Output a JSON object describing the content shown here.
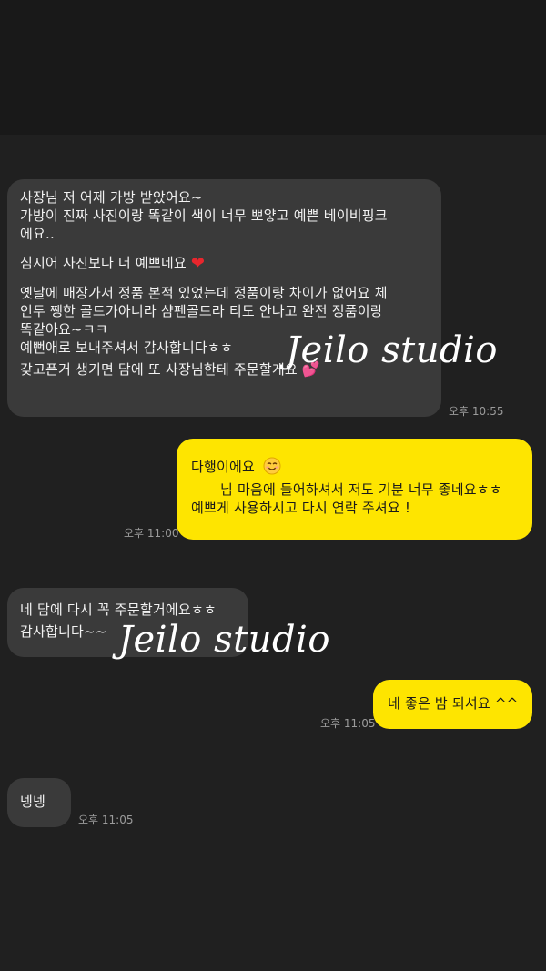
{
  "messages": [
    {
      "direction": "incoming",
      "lines": [
        "사장님 저 어제 가방 받았어요~",
        "가방이 진짜 사진이랑 똑같이 색이 너무 뽀얗고 예쁜 베이비핑크",
        "에요..",
        "심지어 사진보다 더 예쁘네요",
        "옛날에 매장가서 정품 본적 있었는데 정품이랑 차이가 없어요 체",
        "인두 쨍한 골드가아니라 샴펜골드라 티도 안나고 완전 정품이랑",
        "똑같아요~ㅋㅋ",
        "예뻔애로 보내주셔서 감사합니다ㅎㅎ",
        "갖고픈거 생기면 담에 또 사장님한테 주문할게요"
      ],
      "time": "오후 10:55"
    },
    {
      "direction": "outgoing",
      "lines": [
        "다행이에요",
        "님 마음에 들어하셔서 저도 기분 너무 좋네요ㅎㅎ",
        "예쁘게 사용하시고 다시 연락 주셔요 !"
      ],
      "time": "오후 11:00"
    },
    {
      "direction": "incoming",
      "lines": [
        "네 담에 다시 꼭 주문할거에요ㅎㅎ",
        "감사합니다~~"
      ],
      "time": ""
    },
    {
      "direction": "outgoing",
      "lines": [
        "네 좋은 밤 되셔요 ^^"
      ],
      "time": "오후 11:05"
    },
    {
      "direction": "incoming",
      "lines": [
        "넹넹"
      ],
      "time": "오후 11:05"
    }
  ],
  "emoji": {
    "heart": "❤",
    "two_hearts": "💕",
    "smile": "smiling-face-icon"
  },
  "watermark": {
    "text_1": "Jeilo studio",
    "text_2": "Jeilo studio"
  },
  "colors": {
    "background": "#202020",
    "incoming_bubble": "#3a3a3a",
    "outgoing_bubble": "#fee500",
    "timestamp": "#9b9b9b"
  }
}
